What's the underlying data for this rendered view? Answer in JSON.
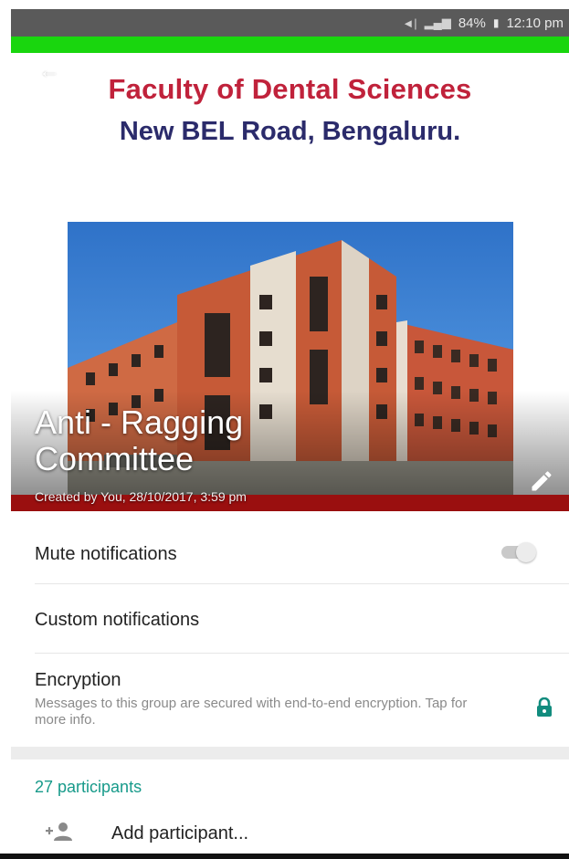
{
  "status_bar": {
    "icons": [
      "mute-icon",
      "signal-icon",
      "battery-icon"
    ],
    "battery": "84%",
    "time": "12:10 pm"
  },
  "header": {
    "college_name": "Faculty of Dental Sciences",
    "college_address": "New BEL Road, Bengaluru.",
    "group_name": "Anti - Ragging Committee",
    "created_by": "Created by You, 28/10/2017, 3:59 pm"
  },
  "settings": {
    "mute_label": "Mute notifications",
    "mute_enabled": false,
    "custom_label": "Custom notifications",
    "encryption_label": "Encryption",
    "encryption_desc": "Messages to this group are secured with end-to-end encryption. Tap for more info."
  },
  "participants": {
    "count_label": "27 participants",
    "add_label": "Add participant..."
  },
  "colors": {
    "accent": "#179a8a",
    "status_bar": "#5a5a5a",
    "green_strip": "#19d60e",
    "red_bar": "#9a0f0f",
    "college_red": "#c0223b",
    "college_navy": "#2b2b6b"
  }
}
